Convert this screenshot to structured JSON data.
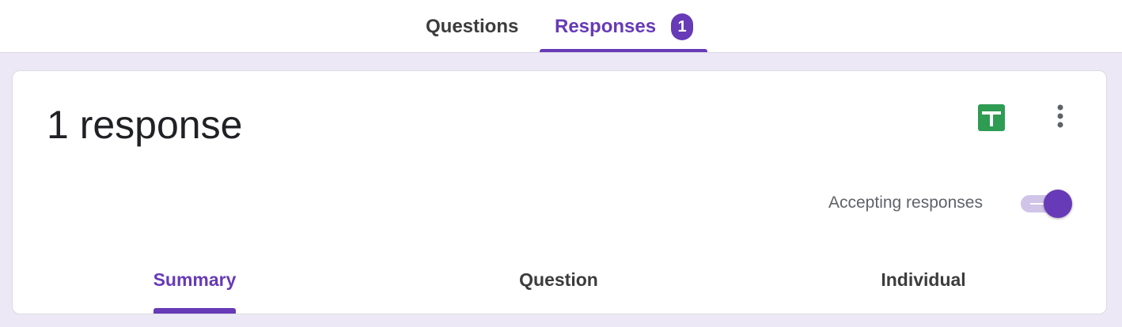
{
  "tabs": {
    "questions_label": "Questions",
    "responses_label": "Responses",
    "responses_badge": "1",
    "active": "Responses"
  },
  "card": {
    "title": "1 response",
    "accepting_label": "Accepting responses",
    "accepting_on": true,
    "icons": {
      "sheets": "google-sheets-icon",
      "more": "more-vert-icon"
    }
  },
  "subtabs": {
    "summary_label": "Summary",
    "question_label": "Question",
    "individual_label": "Individual",
    "active": "Summary"
  },
  "colors": {
    "accent": "#673ab7",
    "sheets_green": "#2e9c52",
    "background": "#ece8f5"
  }
}
